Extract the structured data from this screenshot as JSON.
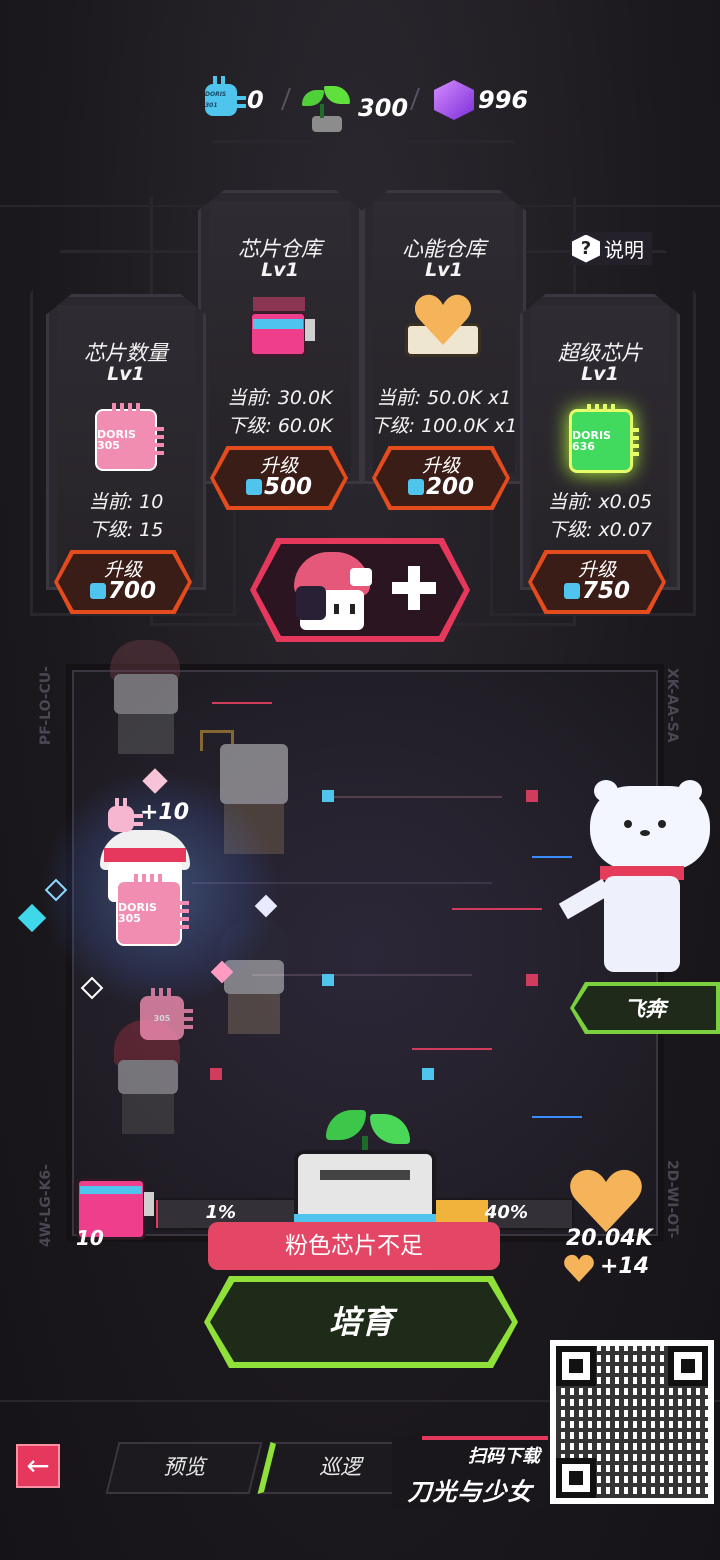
{
  "currency": {
    "chips": "0",
    "chip_icon_text": "DORIS 301",
    "sprouts": "300",
    "gems": "996"
  },
  "info": {
    "label": "说明"
  },
  "panels": {
    "chip_count": {
      "title": "芯片数量",
      "level": "Lv1",
      "current": "当前: 10",
      "next": "下级: 15",
      "chip_text": "DORIS 305",
      "button": "升级",
      "cost": "700"
    },
    "chip_storage": {
      "title": "芯片仓库",
      "level": "Lv1",
      "current": "当前: 30.0K",
      "next": "下级: 60.0K",
      "button": "升级",
      "cost": "500"
    },
    "heart_storage": {
      "title": "心能仓库",
      "level": "Lv1",
      "current": "当前: 50.0K x1",
      "next": "下级: 100.0K x1",
      "button": "升级",
      "cost": "200"
    },
    "super_chip": {
      "title": "超级芯片",
      "level": "Lv1",
      "current": "当前: x0.05",
      "next": "下级: x0.07",
      "chip_text": "DORIS 636",
      "button": "升级",
      "cost": "750"
    }
  },
  "field": {
    "left_code": "PF-LO-CU-",
    "right_code": "XK-AA-SA",
    "left_code_2": "4W-LG-K6-",
    "right_code_2": "2D-WI-OT-",
    "gain_text": "+10",
    "chip_text": "DORIS 305",
    "chip_text_small": "305"
  },
  "side_tag": {
    "label": "飞奔"
  },
  "bars": {
    "chip_bar_percent": "1%",
    "chip_bar_fill": 0.01,
    "heart_bar_percent": "40%",
    "heart_bar_fill": 0.4,
    "chip_count": "10",
    "heart_total": "20.04K",
    "heart_gain": "+14"
  },
  "warning": {
    "text": "粉色芯片不足"
  },
  "actions": {
    "cultivate": "培育"
  },
  "bottom": {
    "preview": "预览",
    "patrol": "巡逻",
    "back_icon": "←"
  },
  "promo": {
    "line1": "扫码下载",
    "line2": "刀光与少女"
  },
  "colors": {
    "upgrade_orange": "#e44b1d",
    "chip_pink": "#f28db2",
    "chip_blue": "#4fc4ec",
    "chip_green": "#42d95f",
    "accent_green": "#8fe13a",
    "warn_pink": "#e44766"
  }
}
